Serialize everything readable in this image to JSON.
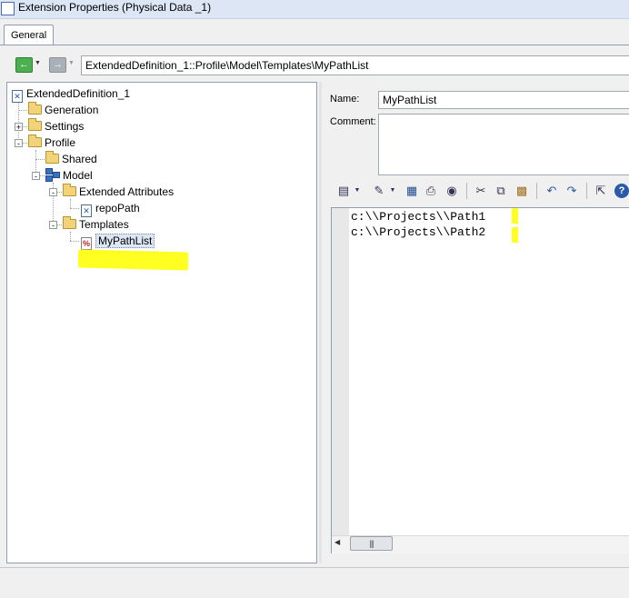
{
  "window": {
    "title": "Extension Properties (Physical Data _1)",
    "title_icon": "extension-icon"
  },
  "tabs": [
    {
      "label": "General",
      "active": true
    }
  ],
  "nav": {
    "back_icon": "back-arrow-icon",
    "forward_icon": "forward-arrow-icon",
    "path": "ExtendedDefinition_1::Profile\\Model\\Templates\\MyPathList"
  },
  "tree": {
    "root": "ExtendedDefinition_1",
    "items": [
      {
        "label": "Generation",
        "icon": "folder-icon",
        "level": 1
      },
      {
        "label": "Settings",
        "icon": "folder-icon",
        "level": 1,
        "expander": "+"
      },
      {
        "label": "Profile",
        "icon": "folder-icon",
        "level": 1,
        "expander": "-"
      },
      {
        "label": "Shared",
        "icon": "folder-icon",
        "level": 2
      },
      {
        "label": "Model",
        "icon": "model-icon",
        "level": 2,
        "expander": "-"
      },
      {
        "label": "Extended Attributes",
        "icon": "folder-icon",
        "level": 3,
        "expander": "-"
      },
      {
        "label": "repoPath",
        "icon": "extended-attribute-icon",
        "level": 4
      },
      {
        "label": "Templates",
        "icon": "folder-icon",
        "level": 3,
        "expander": "-"
      },
      {
        "label": "MyPathList",
        "icon": "template-icon",
        "level": 4,
        "selected": true
      }
    ]
  },
  "form": {
    "name_label": "Name:",
    "name_value": "MyPathList",
    "comment_label": "Comment:",
    "comment_value": ""
  },
  "toolbar": {
    "icons": [
      "editor-menu-icon",
      "insert-menu-icon",
      "save-icon",
      "print-icon",
      "find-icon",
      "cut-icon",
      "copy-icon",
      "paste-icon",
      "undo-icon",
      "redo-icon",
      "open-editor-icon",
      "help-icon"
    ]
  },
  "editor": {
    "lines": [
      "c:\\\\Projects\\\\Path1",
      "c:\\\\Projects\\\\Path2"
    ]
  },
  "colors": {
    "highlight": "#ffff22",
    "selection": "#dde7f4"
  }
}
